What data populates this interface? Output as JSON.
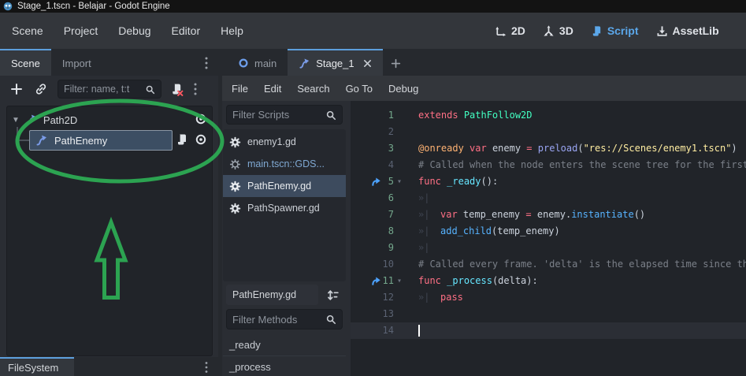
{
  "colors": {
    "accent_blue": "#5d9fdd",
    "script_active_blue": "#5ba7ea",
    "selection": "#3d4b5e",
    "annotation_green": "#2ca351",
    "syntax": {
      "keyword": "#ff7085",
      "annotation": "#ffb373",
      "base_type": "#42ffc2",
      "global_function": "#9aa5f3",
      "string": "#ffeda1",
      "comment": "#7b8089",
      "function_call": "#57b3ff",
      "function_def": "#66e6ff",
      "text": "#ccd3dd"
    }
  },
  "title_bar": {
    "title": "Stage_1.tscn - Belajar - Godot Engine"
  },
  "main_menu": {
    "items": [
      "Scene",
      "Project",
      "Debug",
      "Editor",
      "Help"
    ]
  },
  "workspaces": [
    {
      "label": "2D"
    },
    {
      "label": "3D"
    },
    {
      "label": "Script",
      "active": true
    },
    {
      "label": "AssetLib"
    }
  ],
  "left_dock": {
    "tab_scene": "Scene",
    "tab_import": "Import",
    "filter_placeholder": "Filter: name, t:t",
    "tree": [
      {
        "name": "Path2D"
      },
      {
        "name": "PathEnemy",
        "selected": true
      }
    ],
    "filesystem_label": "FileSystem"
  },
  "scene_tabs": {
    "main_label": "main",
    "stage_label": "Stage_1"
  },
  "script_menu": {
    "items": [
      "File",
      "Edit",
      "Search",
      "Go To",
      "Debug"
    ]
  },
  "script_panel": {
    "filter_scripts_placeholder": "Filter Scripts",
    "scripts": [
      {
        "label": "enemy1.gd"
      },
      {
        "label": "main.tscn::GDS...",
        "builtin": true
      },
      {
        "label": "PathEnemy.gd",
        "selected": true
      },
      {
        "label": "PathSpawner.gd"
      }
    ],
    "current_script": "PathEnemy.gd",
    "filter_methods_placeholder": "Filter Methods",
    "methods": [
      "_ready",
      "_process"
    ]
  },
  "code": {
    "lines": [
      {
        "n": "1",
        "safe": true,
        "seg": [
          [
            "kw",
            "extends"
          ],
          [
            "t",
            " "
          ],
          [
            "ty",
            "PathFollow2D"
          ]
        ]
      },
      {
        "n": "2",
        "seg": []
      },
      {
        "n": "3",
        "safe": true,
        "seg": [
          [
            "an",
            "@onready"
          ],
          [
            "t",
            " "
          ],
          [
            "kw",
            "var"
          ],
          [
            "t",
            " enemy "
          ],
          [
            "kw",
            "="
          ],
          [
            "t",
            " "
          ],
          [
            "gf",
            "preload"
          ],
          [
            "t",
            "("
          ],
          [
            "st",
            "\"res://Scenes/enemy1.tscn\""
          ],
          [
            "t",
            ")"
          ]
        ]
      },
      {
        "n": "4",
        "seg": [
          [
            "co",
            "# Called when the node enters the scene tree for the first time."
          ]
        ]
      },
      {
        "n": "5",
        "ovr": true,
        "fold": true,
        "safe": true,
        "seg": [
          [
            "kw",
            "func"
          ],
          [
            "t",
            " "
          ],
          [
            "fd",
            "_ready"
          ],
          [
            "t",
            "():"
          ]
        ]
      },
      {
        "n": "6",
        "safe": true,
        "seg": [
          [
            "tab",
            ""
          ]
        ]
      },
      {
        "n": "7",
        "safe": true,
        "seg": [
          [
            "tab",
            ""
          ],
          [
            "kw",
            "var"
          ],
          [
            "t",
            " temp_enemy "
          ],
          [
            "kw",
            "="
          ],
          [
            "t",
            " enemy."
          ],
          [
            "fc",
            "instantiate"
          ],
          [
            "t",
            "()"
          ]
        ]
      },
      {
        "n": "8",
        "safe": true,
        "seg": [
          [
            "tab",
            ""
          ],
          [
            "fc",
            "add_child"
          ],
          [
            "t",
            "(temp_enemy)"
          ]
        ]
      },
      {
        "n": "9",
        "safe": true,
        "seg": [
          [
            "tab",
            ""
          ]
        ]
      },
      {
        "n": "10",
        "seg": [
          [
            "co",
            "# Called every frame. 'delta' is the elapsed time since the previous frame."
          ]
        ]
      },
      {
        "n": "11",
        "ovr": true,
        "fold": true,
        "safe": true,
        "seg": [
          [
            "kw",
            "func"
          ],
          [
            "t",
            " "
          ],
          [
            "fd",
            "_process"
          ],
          [
            "t",
            "(delta):"
          ]
        ]
      },
      {
        "n": "12",
        "seg": [
          [
            "tab",
            ""
          ],
          [
            "kw",
            "pass"
          ]
        ]
      },
      {
        "n": "13",
        "seg": []
      },
      {
        "n": "14",
        "cur": true,
        "caret": true,
        "seg": []
      }
    ]
  }
}
